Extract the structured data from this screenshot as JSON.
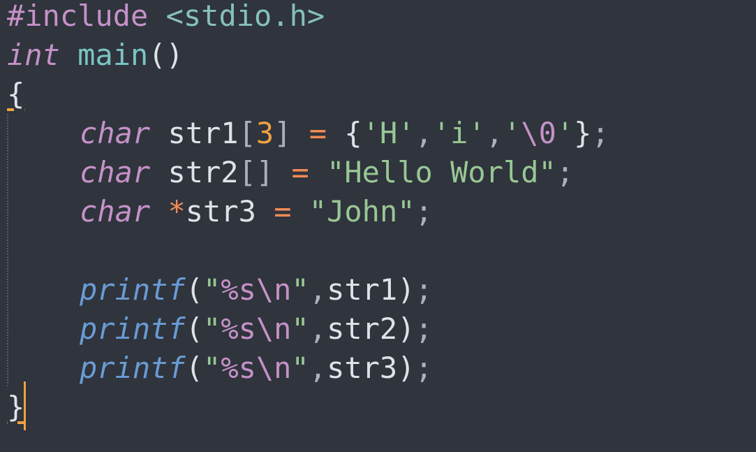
{
  "editor": {
    "lines": [
      {
        "pp": "#include",
        "sp": " ",
        "inc": "<stdio.h>"
      },
      {
        "kw": "int",
        "sp": " ",
        "fn": "main",
        "paren": "()"
      },
      {
        "brace": "{"
      },
      {
        "kw": "char",
        "sp": " ",
        "var": "str1",
        "lb": "[",
        "num": "3",
        "rb": "]",
        "sp2": " ",
        "eq": "=",
        "sp3": " ",
        "open": "{",
        "c1": "'H'",
        "comma1": ",",
        "c2": "'i'",
        "comma2": ",",
        "c3a": "'",
        "c3esc": "\\0",
        "c3b": "'",
        "close": "}",
        "semi": ";"
      },
      {
        "kw": "char",
        "sp": " ",
        "var": "str2",
        "brackets": "[]",
        "sp2": " ",
        "eq": "=",
        "sp3": " ",
        "str": "\"Hello World\"",
        "semi": ";"
      },
      {
        "kw": "char",
        "sp": " ",
        "star": "*",
        "var": "str3",
        "sp2": " ",
        "eq": "=",
        "sp3": " ",
        "str": "\"John\"",
        "semi": ";"
      },
      {},
      {
        "call": "printf",
        "lp": "(",
        "q1": "\"",
        "fmt": "%s",
        "esc": "\\n",
        "q2": "\"",
        "comma": ",",
        "arg": "str1",
        "rp": ")",
        "semi": ";"
      },
      {
        "call": "printf",
        "lp": "(",
        "q1": "\"",
        "fmt": "%s",
        "esc": "\\n",
        "q2": "\"",
        "comma": ",",
        "arg": "str2",
        "rp": ")",
        "semi": ";"
      },
      {
        "call": "printf",
        "lp": "(",
        "q1": "\"",
        "fmt": "%s",
        "esc": "\\n",
        "q2": "\"",
        "comma": ",",
        "arg": "str3",
        "rp": ")",
        "semi": ";"
      },
      {
        "brace": "}"
      }
    ]
  },
  "colors": {
    "background": "#2f343d",
    "keyword": "#c591c7",
    "function_call": "#6a9bd4",
    "string": "#99c794",
    "number": "#f0a142",
    "operator": "#f28b54",
    "cursor": "#f0a142"
  }
}
